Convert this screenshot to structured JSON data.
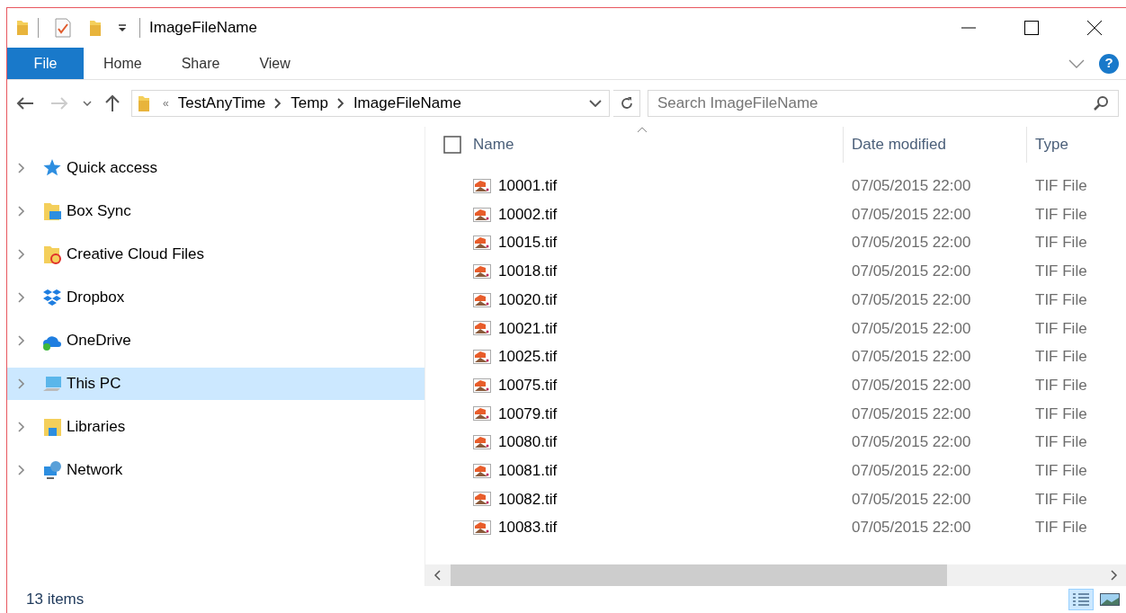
{
  "window": {
    "title": "ImageFileName"
  },
  "ribbon_tabs": [
    {
      "label": "File",
      "kind": "file"
    },
    {
      "label": "Home",
      "kind": "tab"
    },
    {
      "label": "Share",
      "kind": "tab"
    },
    {
      "label": "View",
      "kind": "tab"
    }
  ],
  "help": "?",
  "address": {
    "overflow": "«",
    "crumbs": [
      "TestAnyTime",
      "Temp",
      "ImageFileName"
    ]
  },
  "search": {
    "placeholder": "Search ImageFileName"
  },
  "sidebar": {
    "items": [
      {
        "label": "Quick access",
        "kind": "star",
        "selected": false
      },
      {
        "label": "Box Sync",
        "kind": "box",
        "selected": false
      },
      {
        "label": "Creative Cloud Files",
        "kind": "cc",
        "selected": false
      },
      {
        "label": "Dropbox",
        "kind": "dropbox",
        "selected": false
      },
      {
        "label": "OneDrive",
        "kind": "onedrive",
        "selected": false
      },
      {
        "label": "This PC",
        "kind": "pc",
        "selected": true
      },
      {
        "label": "Libraries",
        "kind": "libraries",
        "selected": false
      },
      {
        "label": "Network",
        "kind": "network",
        "selected": false
      }
    ]
  },
  "select_all": {
    "checked": false
  },
  "table": {
    "columns": [
      "Name",
      "Date modified",
      "Type"
    ],
    "rows": [
      {
        "name": "10001.tif",
        "date": "07/05/2015 22:00",
        "type": "TIF File"
      },
      {
        "name": "10002.tif",
        "date": "07/05/2015 22:00",
        "type": "TIF File"
      },
      {
        "name": "10015.tif",
        "date": "07/05/2015 22:00",
        "type": "TIF File"
      },
      {
        "name": "10018.tif",
        "date": "07/05/2015 22:00",
        "type": "TIF File"
      },
      {
        "name": "10020.tif",
        "date": "07/05/2015 22:00",
        "type": "TIF File"
      },
      {
        "name": "10021.tif",
        "date": "07/05/2015 22:00",
        "type": "TIF File"
      },
      {
        "name": "10025.tif",
        "date": "07/05/2015 22:00",
        "type": "TIF File"
      },
      {
        "name": "10075.tif",
        "date": "07/05/2015 22:00",
        "type": "TIF File"
      },
      {
        "name": "10079.tif",
        "date": "07/05/2015 22:00",
        "type": "TIF File"
      },
      {
        "name": "10080.tif",
        "date": "07/05/2015 22:00",
        "type": "TIF File"
      },
      {
        "name": "10081.tif",
        "date": "07/05/2015 22:00",
        "type": "TIF File"
      },
      {
        "name": "10082.tif",
        "date": "07/05/2015 22:00",
        "type": "TIF File"
      },
      {
        "name": "10083.tif",
        "date": "07/05/2015 22:00",
        "type": "TIF File"
      }
    ]
  },
  "status_bar": {
    "count": "13 items"
  },
  "view_buttons": [
    {
      "kind": "details",
      "selected": true
    },
    {
      "kind": "thumbnails",
      "selected": false
    }
  ]
}
